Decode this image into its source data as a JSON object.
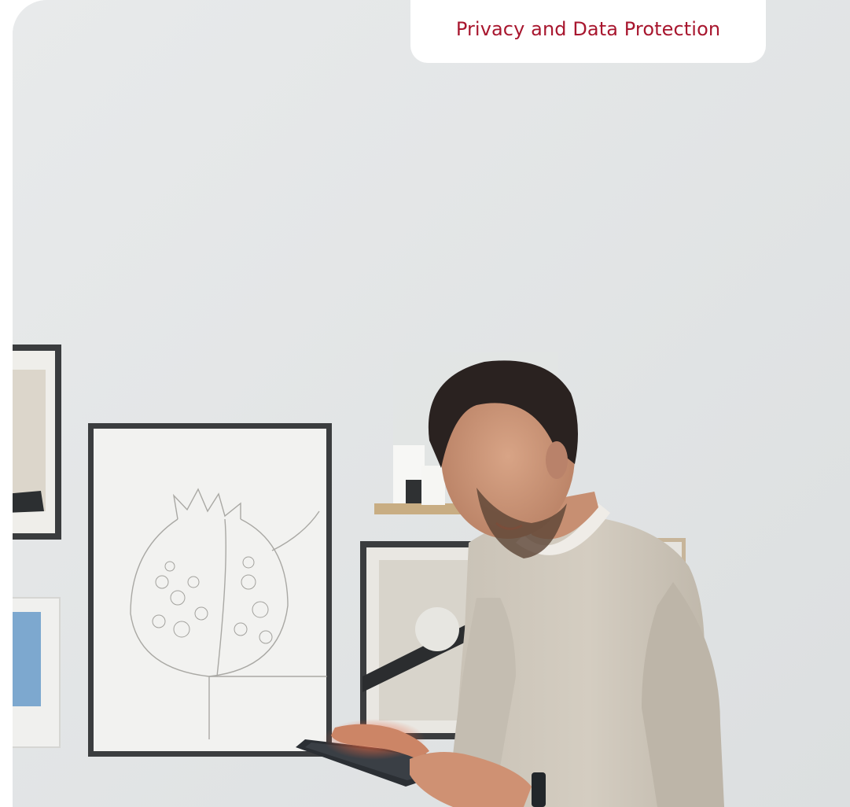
{
  "category_tab": {
    "label": "Privacy and Data Protection"
  },
  "hero_image": {
    "subject": "man-using-tablet",
    "colors": {
      "accent": "#a8162e",
      "wall": "#e5e7e8",
      "sweater": "#cfc8bc"
    }
  }
}
